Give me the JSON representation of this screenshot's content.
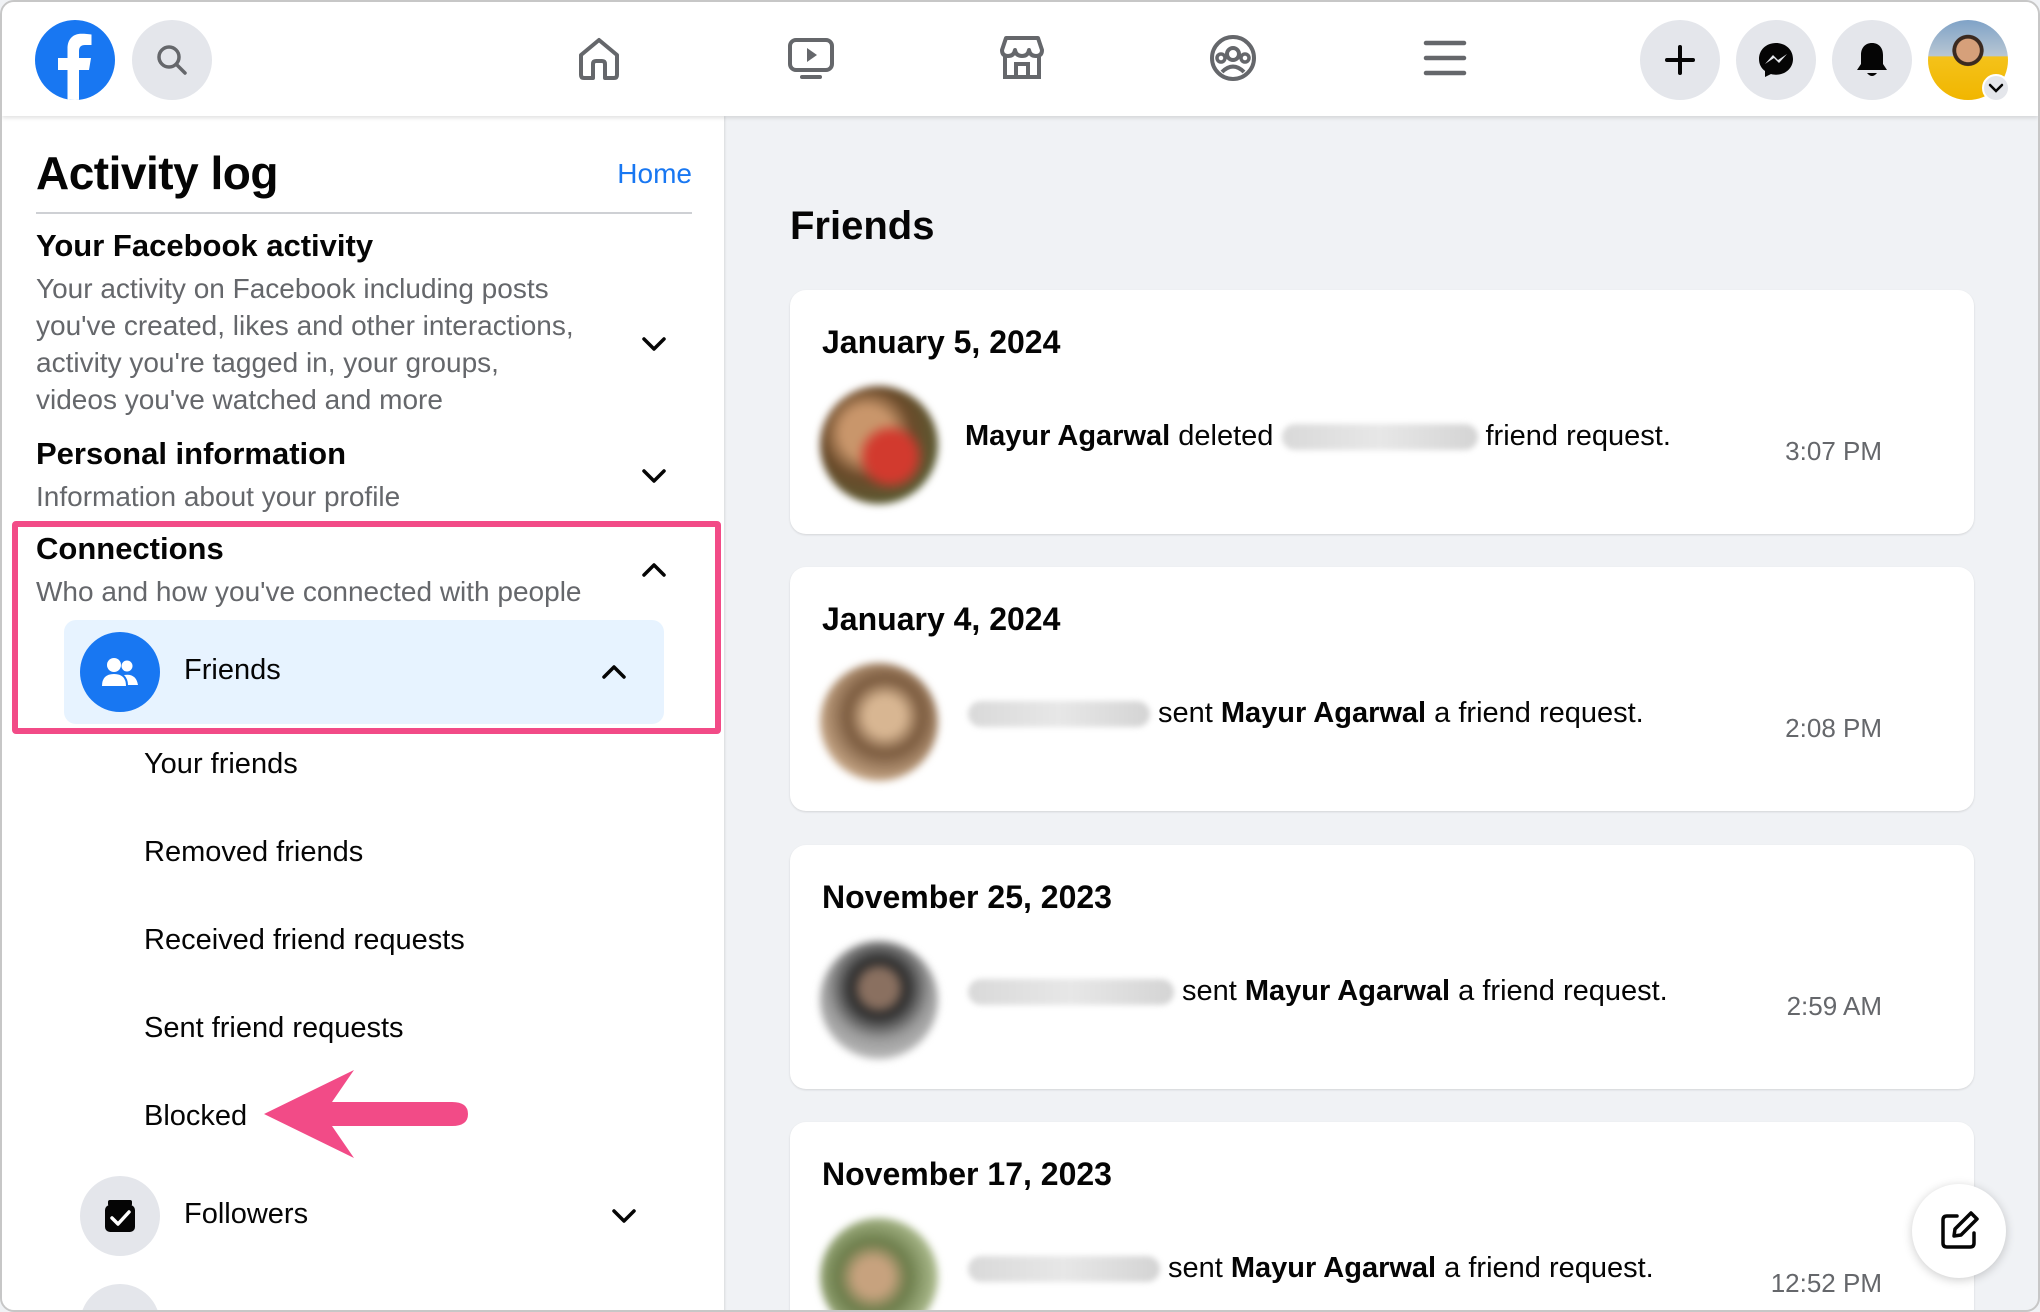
{
  "topbar": {
    "icons": [
      "facebook-logo",
      "search-icon",
      "home-icon",
      "watch-icon",
      "marketplace-icon",
      "groups-icon",
      "menu-icon",
      "create-icon",
      "messenger-icon",
      "notifications-icon",
      "profile-avatar"
    ]
  },
  "sidebar": {
    "title": "Activity log",
    "home_link": "Home",
    "sections": [
      {
        "heading": "Your Facebook activity",
        "desc_lines": [
          "Your activity on Facebook including posts",
          "you've created, likes and other interactions,",
          "activity you're tagged in, your groups,",
          "videos you've watched and more"
        ]
      },
      {
        "heading": "Personal information",
        "desc_lines": [
          "Information about your profile"
        ]
      },
      {
        "heading": "Connections",
        "desc_lines": [
          "Who and how you've connected with people"
        ]
      }
    ],
    "friends": {
      "label": "Friends",
      "sub_items": [
        "Your friends",
        "Removed friends",
        "Received friend requests",
        "Sent friend requests",
        "Blocked"
      ]
    },
    "followers_label": "Followers"
  },
  "main": {
    "title": "Friends",
    "cards": [
      {
        "date": "January 5, 2024",
        "actor": "Mayur Agarwal",
        "action": "deleted",
        "suffix": "friend request.",
        "time": "3:07 PM"
      },
      {
        "date": "January 4, 2024",
        "prefix": "sent",
        "target": "Mayur Agarwal",
        "suffix": "a friend request.",
        "time": "2:08 PM"
      },
      {
        "date": "November 25, 2023",
        "prefix": "sent",
        "target": "Mayur Agarwal",
        "suffix": "a friend request.",
        "time": "2:59 AM"
      },
      {
        "date": "November 17, 2023",
        "prefix": "sent",
        "target": "Mayur Agarwal",
        "suffix": "a friend request.",
        "time": "12:52 PM"
      }
    ]
  },
  "colors": {
    "brand": "#1877f2",
    "highlight": "#f24b87",
    "selected_bg": "#e7f3ff"
  }
}
